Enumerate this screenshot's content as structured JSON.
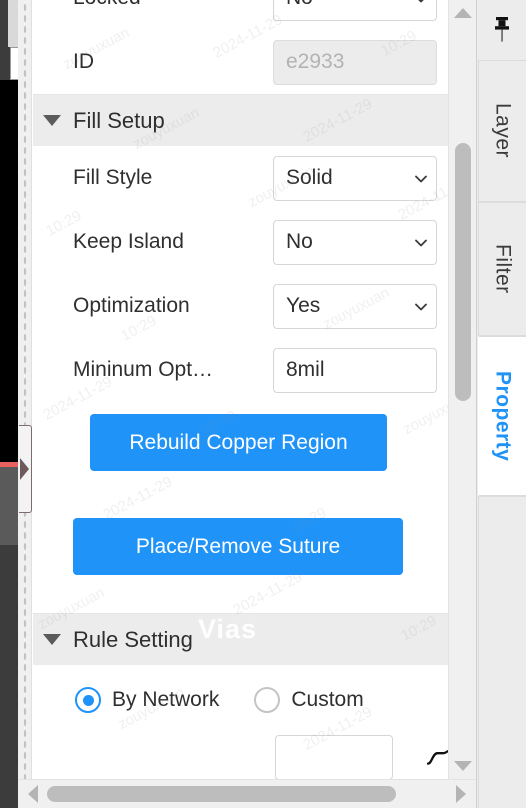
{
  "panel": {
    "rows_top": [
      {
        "label": "Locked",
        "type": "select",
        "value": "No",
        "icon": "chevron-down-icon",
        "name": "locked"
      },
      {
        "label": "ID",
        "type": "text",
        "value": "e2933",
        "disabled": true,
        "name": "id"
      }
    ],
    "sections": [
      {
        "title": "Fill Setup",
        "caret": "caret-down-icon",
        "rows": [
          {
            "label": "Fill Style",
            "type": "select",
            "value": "Solid",
            "icon": "chevron-down-icon",
            "name": "fill-style"
          },
          {
            "label": "Keep Island",
            "type": "select",
            "value": "No",
            "icon": "chevron-down-icon",
            "name": "keep-island"
          },
          {
            "label": "Optimization",
            "type": "select",
            "value": "Yes",
            "icon": "chevron-down-icon",
            "name": "optimization"
          },
          {
            "label": "Mininum Opt…",
            "type": "text",
            "value": "8mil",
            "disabled": false,
            "name": "minimum-opt"
          }
        ],
        "buttons": [
          {
            "label": "Rebuild Copper Region",
            "name": "rebuild-copper-region"
          },
          {
            "label": "Place/Remove Suture",
            "name": "place-remove-suture"
          }
        ]
      },
      {
        "title": "Rule Setting",
        "caret": "caret-down-icon",
        "radios": [
          {
            "label": "By Network",
            "checked": true,
            "name": "by-network"
          },
          {
            "label": "Custom",
            "checked": false,
            "name": "custom"
          }
        ]
      }
    ]
  },
  "rail": {
    "pin": "pin-icon",
    "tabs": [
      {
        "label": "Layer",
        "active": false,
        "name": "layer"
      },
      {
        "label": "Filter",
        "active": false,
        "name": "filter"
      },
      {
        "label": "Property",
        "active": true,
        "name": "property"
      }
    ]
  },
  "watermarks": {
    "vias": "Vias",
    "marks": [
      "zouyuxuan",
      "2024-11-29",
      "10:29",
      "zouyuxuan",
      "2024-11-29",
      "10:29",
      "zouyuxuan",
      "2024-11-29",
      "10:29",
      "zouyuxuan",
      "2024-11-29",
      "10:29",
      "zouyuxuan",
      "2024-11-29",
      "10:29",
      "zouyuxuan",
      "2024-11-29",
      "10:29",
      "zouyuxuan",
      "2024-11-29"
    ]
  },
  "colors": {
    "accent": "#1f93f7",
    "section_header_bg": "#ececec",
    "panel_bg": "#ffffff",
    "text": "#2f2f2f",
    "disabled_text": "#b3b3b3",
    "scrollbar_thumb": "#bdbdbd"
  },
  "scrollbars": {
    "vertical": {
      "name": "vertical-scrollbar"
    },
    "horizontal": {
      "name": "horizontal-scrollbar"
    }
  }
}
